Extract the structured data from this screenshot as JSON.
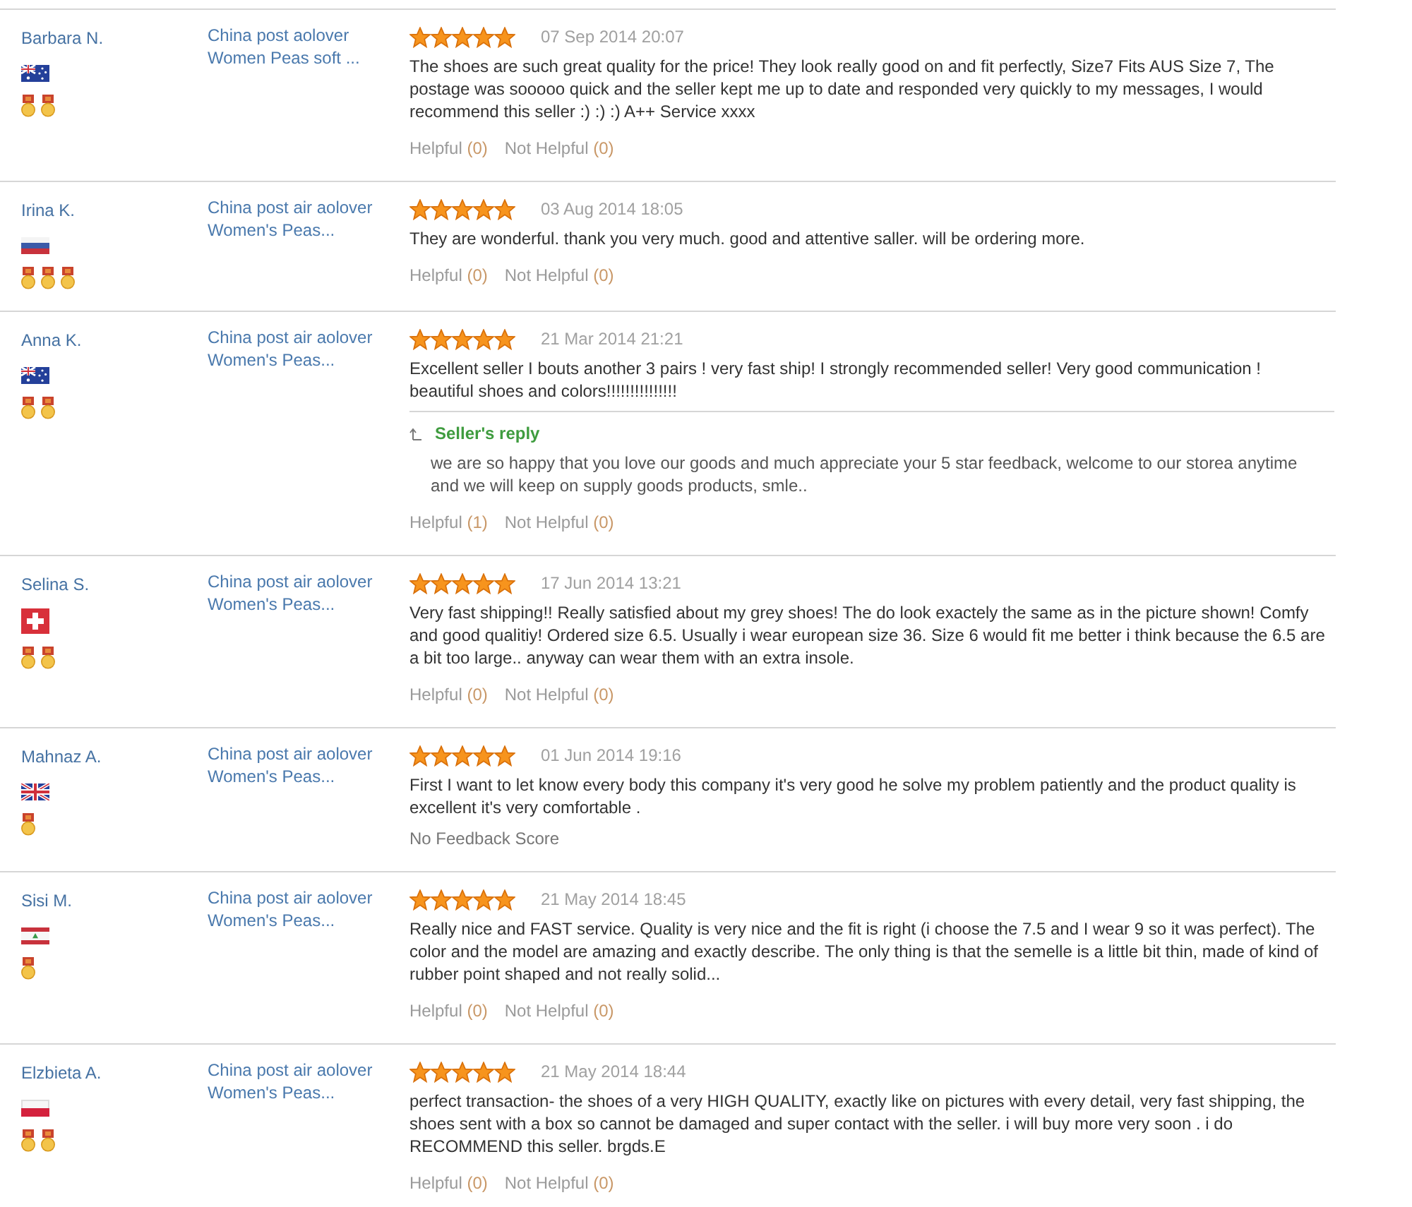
{
  "reviews": [
    {
      "reviewer": {
        "name": "Barbara N.",
        "flag": {
          "kind": "australia"
        },
        "badges": [
          {
            "kind": "medal"
          },
          {
            "kind": "medal"
          }
        ]
      },
      "product": [
        "China post aolover",
        "Women Peas soft ..."
      ],
      "stars": 5,
      "date": "07 Sep 2014 20:07",
      "text": "The shoes are such great quality for the price! They look really good on and fit perfectly, Size7 Fits AUS Size 7, The postage was sooooo quick and the seller kept me up to date and responded very quickly to my messages, I would recommend this seller :) :) :) A++ Service xxxx",
      "helpful": {
        "label": "Helpful",
        "count": "(0)"
      },
      "not_helpful": {
        "label": "Not Helpful",
        "count": "(0)"
      }
    },
    {
      "reviewer": {
        "name": "Irina K.",
        "flag": {
          "kind": "russia"
        },
        "badges": [
          {
            "kind": "medal"
          },
          {
            "kind": "medal"
          },
          {
            "kind": "medal"
          }
        ]
      },
      "product": [
        "China post air aolover",
        "Women's Peas..."
      ],
      "stars": 5,
      "date": "03 Aug 2014 18:05",
      "text": "They are wonderful. thank you very much. good and attentive saller. will be ordering more.",
      "helpful": {
        "label": "Helpful",
        "count": "(0)"
      },
      "not_helpful": {
        "label": "Not Helpful",
        "count": "(0)"
      }
    },
    {
      "reviewer": {
        "name": "Anna K.",
        "flag": {
          "kind": "australia"
        },
        "badges": [
          {
            "kind": "medal"
          },
          {
            "kind": "medal"
          }
        ]
      },
      "product": [
        "China post air aolover",
        "Women's Peas..."
      ],
      "stars": 5,
      "date": "21 Mar 2014 21:21",
      "text": "Excellent seller I bouts another 3 pairs ! very fast ship! I strongly recommended seller! Very good communication ! beautiful shoes and colors!!!!!!!!!!!!!!!",
      "seller_reply": {
        "label": "Seller's reply",
        "text": "we are so happy that you love our goods and much appreciate your 5 star feedback, welcome to our storea anytime and we will keep on supply goods products, smle.."
      },
      "helpful": {
        "label": "Helpful",
        "count": "(1)"
      },
      "not_helpful": {
        "label": "Not Helpful",
        "count": "(0)"
      }
    },
    {
      "reviewer": {
        "name": "Selina S.",
        "flag": {
          "kind": "switzerland"
        },
        "badges": [
          {
            "kind": "medal"
          },
          {
            "kind": "medal"
          }
        ]
      },
      "product": [
        "China post air aolover",
        "Women's Peas..."
      ],
      "stars": 5,
      "date": "17 Jun 2014 13:21",
      "text": "Very fast shipping!! Really satisfied about my grey shoes! The do look exactely the same as in the picture shown! Comfy and good qualitiy! Ordered size 6.5. Usually i wear european size 36. Size 6 would fit me better i think because the 6.5 are a bit too large.. anyway can wear them with an extra insole.",
      "helpful": {
        "label": "Helpful",
        "count": "(0)"
      },
      "not_helpful": {
        "label": "Not Helpful",
        "count": "(0)"
      }
    },
    {
      "reviewer": {
        "name": "Mahnaz A.",
        "flag": {
          "kind": "uk"
        },
        "badges": [
          {
            "kind": "medal"
          }
        ]
      },
      "product": [
        "China post air aolover",
        "Women's Peas..."
      ],
      "stars": 5,
      "date": "01 Jun 2014 19:16",
      "text": "First I want to let know every body this company it's very good he solve my problem patiently and the product quality is excellent it's very comfortable .",
      "note": "No Feedback Score"
    },
    {
      "reviewer": {
        "name": "Sisi M.",
        "flag": {
          "kind": "lebanon"
        },
        "badges": [
          {
            "kind": "medal"
          }
        ]
      },
      "product": [
        "China post air aolover",
        "Women's Peas..."
      ],
      "stars": 5,
      "date": "21 May 2014 18:45",
      "text": "Really nice and FAST service. Quality is very nice and the fit is right (i choose the 7.5 and I wear 9 so it was perfect). The color and the model are amazing and exactly describe. The only thing is that the semelle is a little bit thin, made of kind of rubber point shaped and not really solid...",
      "helpful": {
        "label": "Helpful",
        "count": "(0)"
      },
      "not_helpful": {
        "label": "Not Helpful",
        "count": "(0)"
      }
    },
    {
      "reviewer": {
        "name": "Elzbieta A.",
        "flag": {
          "kind": "poland"
        },
        "badges": [
          {
            "kind": "medal"
          },
          {
            "kind": "medal"
          }
        ]
      },
      "product": [
        "China post air aolover",
        "Women's Peas..."
      ],
      "stars": 5,
      "date": "21 May 2014 18:44",
      "text": "perfect transaction- the shoes of a very HIGH QUALITY, exactly like on pictures with every detail, very fast shipping, the shoes sent with a box so cannot be damaged and super contact with the seller. i will buy more very soon . i do RECOMMEND this seller. brgds.E",
      "helpful": {
        "label": "Helpful",
        "count": "(0)"
      },
      "not_helpful": {
        "label": "Not Helpful",
        "count": "(0)"
      }
    }
  ]
}
